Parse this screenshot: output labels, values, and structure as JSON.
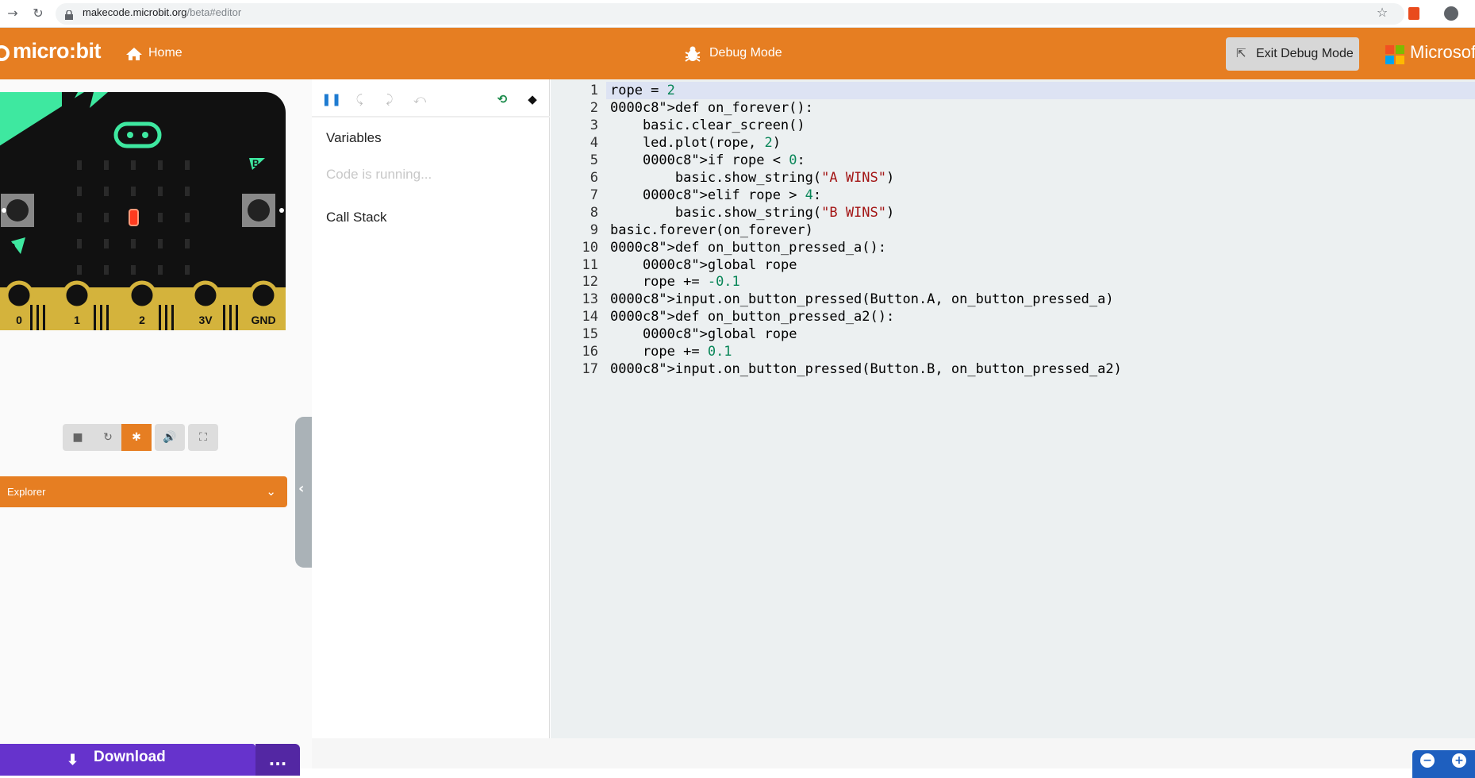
{
  "browser": {
    "url_host": "makecode.microbit.org",
    "url_path": "/beta#editor"
  },
  "topbar": {
    "logo": "micro:bit",
    "home_label": "Home",
    "mode_label": "Debug Mode",
    "exit_label": "Exit Debug Mode",
    "brand": "Microsof"
  },
  "simulator": {
    "pins": [
      "0",
      "1",
      "2",
      "3V",
      "GND"
    ],
    "button_a": "A",
    "button_b": "B",
    "lit_led": "row 3, col 3"
  },
  "explorer_label": "Explorer",
  "debugger": {
    "variables_label": "Variables",
    "status": "Code is running...",
    "callstack_label": "Call Stack"
  },
  "download_label": "Download",
  "more_label": "...",
  "colors": {
    "accent": "#e67e22",
    "download": "#6633cc",
    "editor_bg": "#ecf0f1"
  },
  "code": {
    "lines": [
      "rope = 2",
      "def on_forever():",
      "    basic.clear_screen()",
      "    led.plot(rope, 2)",
      "    if rope < 0:",
      "        basic.show_string(\"A WINS\")",
      "    elif rope > 4:",
      "        basic.show_string(\"B WINS\")",
      "basic.forever(on_forever)",
      "def on_button_pressed_a():",
      "    global rope",
      "    rope += -0.1",
      "input.on_button_pressed(Button.A, on_button_pressed_a)",
      "def on_button_pressed_a2():",
      "    global rope",
      "    rope += 0.1",
      "input.on_button_pressed(Button.B, on_button_pressed_a2)"
    ]
  }
}
